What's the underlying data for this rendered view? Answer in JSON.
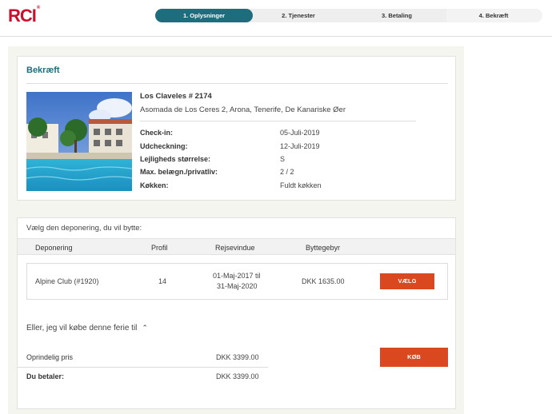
{
  "brand": {
    "logo_text": "RCI",
    "logo_mark": "®",
    "logo_color": "#c8102e"
  },
  "steps": [
    {
      "label": "1. Oplysninger",
      "active": true
    },
    {
      "label": "2. Tjenester",
      "active": false
    },
    {
      "label": "3. Betaling",
      "active": false
    },
    {
      "label": "4. Bekræft",
      "active": false
    }
  ],
  "colors": {
    "accent": "#1d6d7d",
    "button": "#d9481f"
  },
  "confirm": {
    "title": "Bekræft",
    "resort_name": "Los Claveles # 2174",
    "address": "Asomada de Los Ceres 2,  Arona,  Tenerife,  De Kanariske Øer",
    "details": [
      {
        "label": "Check-in:",
        "value": "05-Juli-2019"
      },
      {
        "label": "Udcheckning:",
        "value": "12-Juli-2019"
      },
      {
        "label": "Lejligheds størrelse:",
        "value": "S"
      },
      {
        "label": "Max. belægn./privatliv:",
        "value": "2 / 2"
      },
      {
        "label": "Køkken:",
        "value": "Fuldt køkken"
      }
    ]
  },
  "deposit": {
    "intro": "Vælg den deponering, du vil bytte:",
    "headers": [
      "Deponering",
      "Profil",
      "Rejsevindue",
      "Byttegebyr"
    ],
    "rows": [
      {
        "name": "Alpine Club (#1920)",
        "profile": "14",
        "window_line1": "01-Maj-2017 til",
        "window_line2": "31-Maj-2020",
        "fee": "DKK 1635.00",
        "button": "VÆLG"
      }
    ]
  },
  "buy": {
    "toggle_label": "Eller, jeg vil købe denne ferie til",
    "toggle_icon": "chevron-up-icon",
    "original_label": "Oprindelig pris",
    "original_value": "DKK 3399.00",
    "pay_label": "Du betaler:",
    "pay_value": "DKK 3399.00",
    "button": "KØB"
  }
}
